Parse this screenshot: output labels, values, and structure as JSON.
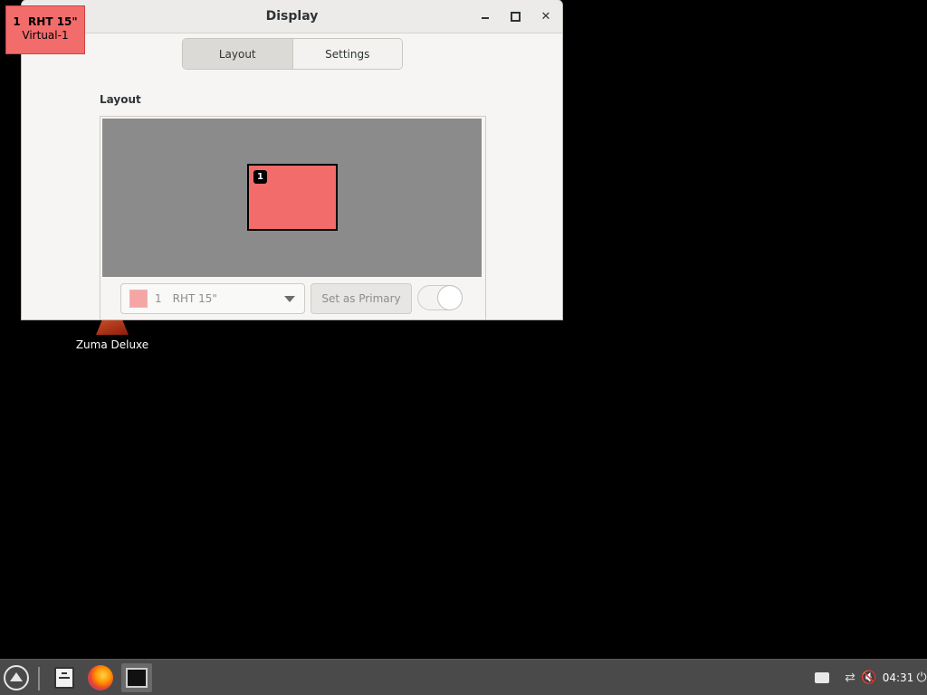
{
  "desktop": {
    "icons": [
      {
        "label": "Zuma Deluxe",
        "icon": "zuma-deluxe-icon"
      }
    ]
  },
  "osd_label": {
    "number": "1",
    "name": "RHT 15\"",
    "connector": "Virtual-1",
    "color": "#f26c6c"
  },
  "window": {
    "title": "Display",
    "controls": {
      "minimize": "minimize-icon",
      "maximize": "maximize-icon",
      "close": "close-icon"
    },
    "tabs": [
      {
        "label": "Layout",
        "active": true
      },
      {
        "label": "Settings",
        "active": false
      }
    ],
    "section_label": "Layout",
    "layout": {
      "monitor_number": "1",
      "monitor_color": "#f26c6c",
      "canvas_color": "#8b8b8b"
    },
    "monitor_select": {
      "swatch_color": "#f6a5a5",
      "number": "1",
      "name": "RHT 15\""
    },
    "primary_button": "Set as Primary",
    "enabled_toggle": {
      "on": false
    }
  },
  "taskbar": {
    "launchers": [
      "start-menu-icon",
      "file-manager-icon",
      "firefox-icon",
      "terminal-icon"
    ],
    "tray": [
      "printer-icon",
      "network-icon",
      "volume-muted-icon"
    ],
    "clock": "04:31"
  }
}
